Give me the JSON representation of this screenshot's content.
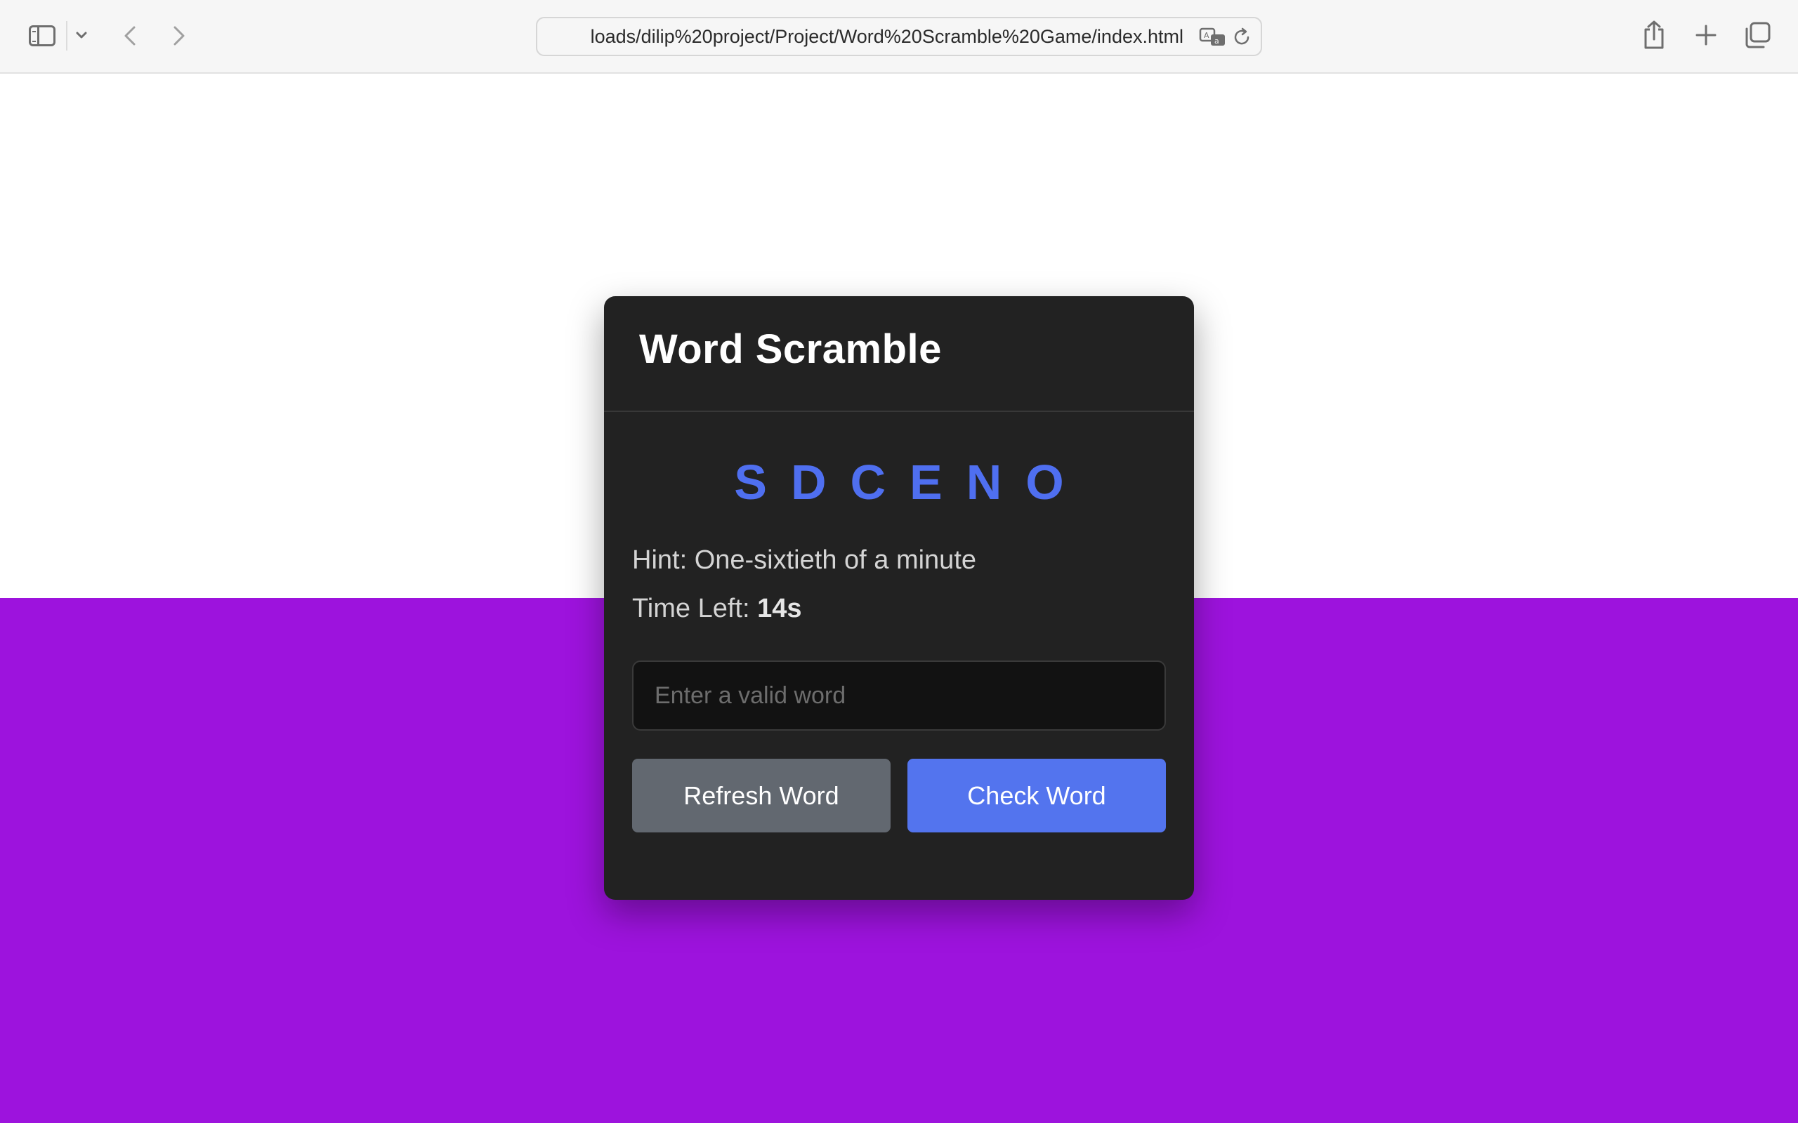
{
  "browser": {
    "url": "loads/dilip%20project/Project/Word%20Scramble%20Game/index.html",
    "icons": [
      "sidebar-icon",
      "chevron-down-icon",
      "back-arrow-icon",
      "forward-arrow-icon",
      "translate-icon",
      "reload-icon",
      "share-icon",
      "plus-icon",
      "tabs-icon"
    ]
  },
  "colors": {
    "page_top": "#ffffff",
    "page_bottom": "#9d13dd",
    "card": "#222222",
    "scrambled_letters": "#4f6ff0",
    "refresh_button": "#626870",
    "check_button": "#5374ee"
  },
  "game": {
    "title": "Word Scramble",
    "scrambled_word": "SDCENO",
    "hint_label": "Hint:",
    "hint_text": "One-sixtieth of a minute",
    "timer_label": "Time Left:",
    "timer_value": "14s",
    "input_placeholder": "Enter a valid word",
    "input_value": "",
    "refresh_label": "Refresh Word",
    "check_label": "Check Word"
  }
}
